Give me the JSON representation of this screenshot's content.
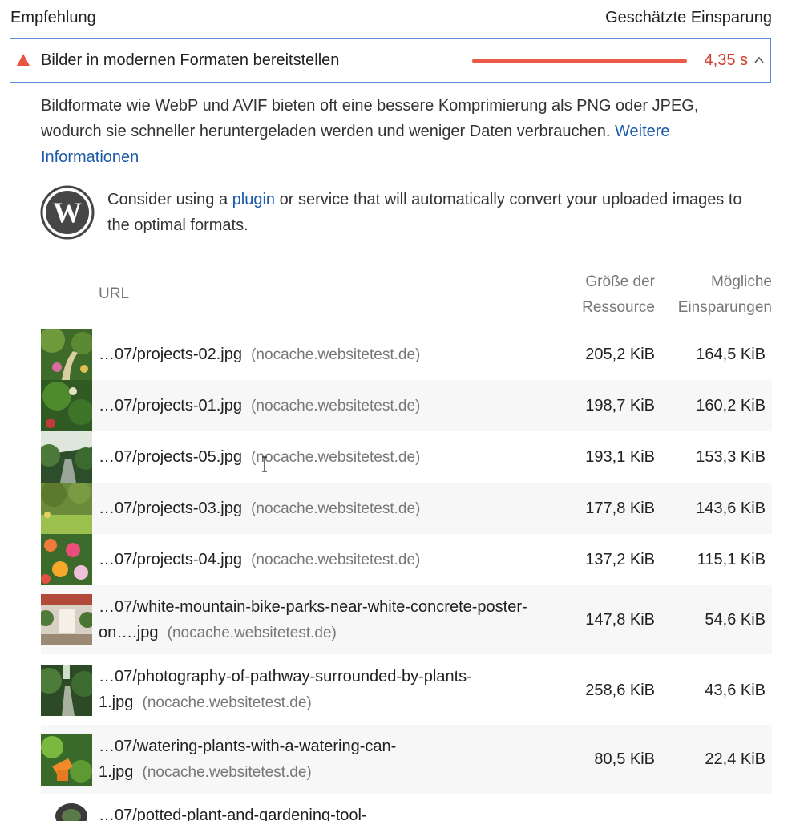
{
  "header": {
    "recommendation": "Empfehlung",
    "estimated_savings": "Geschätzte Einsparung"
  },
  "audit": {
    "title": "Bilder in modernen Formaten bereitstellen",
    "savings": "4,35 s",
    "severity_color": "#e8543e",
    "expanded": true
  },
  "description": {
    "text": "Bildformate wie WebP und AVIF bieten oft eine bessere Komprimierung als PNG oder JPEG, wodurch sie schneller heruntergeladen werden und weniger Daten verbrauchen. ",
    "link": "Weitere Informationen"
  },
  "wordpress_tip": {
    "before": "Consider using a ",
    "link": "plugin",
    "after": " or service that will automatically convert your uploaded images to the optimal formats."
  },
  "table": {
    "headers": {
      "url": "URL",
      "size_line1": "Größe der",
      "size_line2": "Ressource",
      "savings_line1": "Mögliche",
      "savings_line2": "Einsparungen"
    },
    "rows": [
      {
        "line1": "…07/projects-02.jpg",
        "line2": "",
        "host": "(nocache.websitetest.de)",
        "size": "205,2 KiB",
        "savings": "164,5 KiB"
      },
      {
        "line1": "…07/projects-01.jpg",
        "line2": "",
        "host": "(nocache.websitetest.de)",
        "size": "198,7 KiB",
        "savings": "160,2 KiB"
      },
      {
        "line1": "…07/projects-05.jpg",
        "line2": "",
        "host": "(nocache.websitetest.de)",
        "size": "193,1 KiB",
        "savings": "153,3 KiB"
      },
      {
        "line1": "…07/projects-03.jpg",
        "line2": "",
        "host": "(nocache.websitetest.de)",
        "size": "177,8 KiB",
        "savings": "143,6 KiB"
      },
      {
        "line1": "…07/projects-04.jpg",
        "line2": "",
        "host": "(nocache.websitetest.de)",
        "size": "137,2 KiB",
        "savings": "115,1 KiB"
      },
      {
        "line1": "…07/white-mountain-bike-parks-near-white-concrete-poster-",
        "line2": "on….jpg",
        "host": "(nocache.websitetest.de)",
        "size": "147,8 KiB",
        "savings": "54,6 KiB"
      },
      {
        "line1": "…07/photography-of-pathway-surrounded-by-plants-",
        "line2": "1.jpg",
        "host": "(nocache.websitetest.de)",
        "size": "258,6 KiB",
        "savings": "43,6 KiB"
      },
      {
        "line1": "…07/watering-plants-with-a-watering-can-",
        "line2": "1.jpg",
        "host": "(nocache.websitetest.de)",
        "size": "80,5 KiB",
        "savings": "22,4 KiB"
      },
      {
        "line1": "…07/potted-plant-and-gardening-tool-",
        "line2": "",
        "host": "",
        "size": "",
        "savings": ""
      }
    ]
  }
}
